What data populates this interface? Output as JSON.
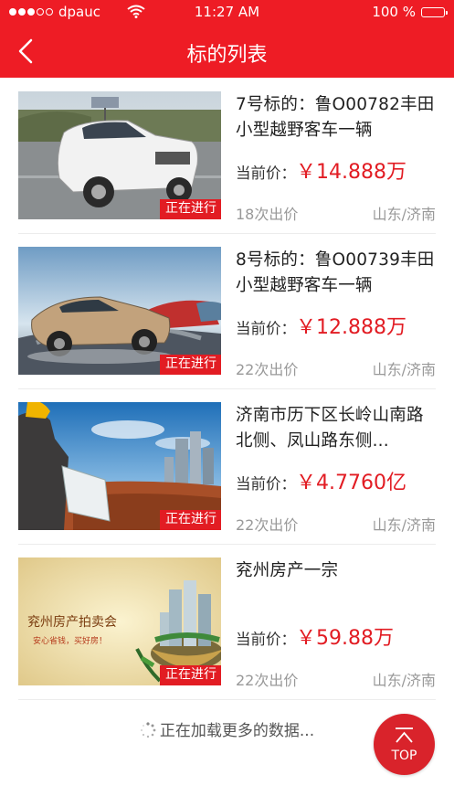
{
  "status_bar": {
    "carrier": "dpauc",
    "time": "11:27 AM",
    "battery": "100 %",
    "battery_level": 1.0
  },
  "header": {
    "title": "标的列表"
  },
  "items": [
    {
      "title": "7号标的：鲁O00782丰田小型越野客车一辆",
      "price_label": "当前价：",
      "price": "￥14.888万",
      "bids": "18次出价",
      "location": "山东/济南",
      "status": "正在进行"
    },
    {
      "title": "8号标的：鲁O00739丰田小型越野客车一辆",
      "price_label": "当前价：",
      "price": "￥12.888万",
      "bids": "22次出价",
      "location": "山东/济南",
      "status": "正在进行"
    },
    {
      "title": "济南市历下区长岭山南路北侧、凤山路东侧...",
      "price_label": "当前价：",
      "price": "￥4.7760亿",
      "bids": "22次出价",
      "location": "山东/济南",
      "status": "正在进行"
    },
    {
      "title": "兖州房产一宗",
      "price_label": "当前价：",
      "price": "￥59.88万",
      "bids": "22次出价",
      "location": "山东/济南",
      "status": "正在进行"
    }
  ],
  "thumb_text": {
    "auction_title": "兖州房产拍卖会",
    "auction_slogan": "安心省钱，买好房！"
  },
  "loading": {
    "text": "正在加载更多的数据..."
  },
  "top_button": {
    "label": "TOP"
  },
  "colors": {
    "brand": "#ee1c25",
    "price": "#e21c23"
  }
}
